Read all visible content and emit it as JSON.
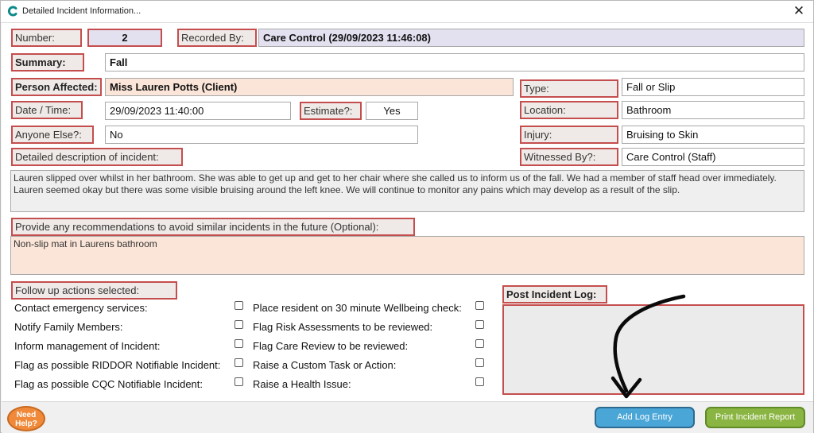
{
  "window": {
    "title": "Detailed Incident Information...",
    "close_glyph": "✕"
  },
  "form": {
    "number_label": "Number:",
    "number_value": "2",
    "recorded_by_label": "Recorded By:",
    "recorded_by_value": "Care Control (29/09/2023 11:46:08)",
    "summary_label": "Summary:",
    "summary_value": "Fall",
    "person_affected_label": "Person Affected:",
    "person_affected_value": "Miss Lauren Potts (Client)",
    "type_label": "Type:",
    "type_value": "Fall or Slip",
    "datetime_label": "Date / Time:",
    "datetime_value": "29/09/2023 11:40:00",
    "estimate_label": "Estimate?:",
    "estimate_value": "Yes",
    "location_label": "Location:",
    "location_value": "Bathroom",
    "anyone_else_label": "Anyone Else?:",
    "anyone_else_value": "No",
    "injury_label": "Injury:",
    "injury_value": "Bruising to Skin",
    "description_label": "Detailed description of incident:",
    "witnessed_by_label": "Witnessed By?:",
    "witnessed_by_value": "Care Control (Staff)",
    "description_text": "Lauren slipped over whilst in her bathroom. She was able to get up and get to her chair where she called us to inform us of the fall. We had a member of staff head over immediately. Lauren seemed okay but there was some visible bruising around the left knee. We will continue to monitor any pains which may develop as a result of the slip.",
    "recommendations_label": "Provide any recommendations to avoid similar incidents in the future (Optional):",
    "recommendations_text": "Non-slip mat in Laurens bathroom"
  },
  "follow_up": {
    "label": "Follow up actions selected:",
    "left_actions": [
      {
        "label": "Contact emergency services:",
        "checked": false
      },
      {
        "label": "Notify Family Members:",
        "checked": false
      },
      {
        "label": "Inform management of Incident:",
        "checked": false
      },
      {
        "label": "Flag as possible RIDDOR Notifiable Incident:",
        "checked": false
      },
      {
        "label": "Flag as possible CQC Notifiable Incident:",
        "checked": false
      }
    ],
    "right_actions": [
      {
        "label": "Place resident on 30 minute Wellbeing check:",
        "checked": false
      },
      {
        "label": "Flag Risk Assessments to be reviewed:",
        "checked": false
      },
      {
        "label": "Flag Care Review to be reviewed:",
        "checked": false
      },
      {
        "label": "Raise a Custom Task or Action:",
        "checked": false
      },
      {
        "label": "Raise a Health Issue:",
        "checked": false
      }
    ]
  },
  "post_incident_log": {
    "label": "Post Incident Log:"
  },
  "footer": {
    "help_line1": "Need",
    "help_line2": "Help?",
    "add_log_label": "Add Log Entry",
    "print_label": "Print Incident Report"
  },
  "colors": {
    "label_border": "#c44e4e",
    "label_bg": "#efeae7",
    "purple_field": "#e3e0f0",
    "peach_field": "#fbe5d8",
    "help_button": "#f08a3a",
    "add_log_button": "#4ba6d8",
    "print_button": "#8bb543"
  },
  "icons": {
    "app": "app-c-icon",
    "close": "close-icon",
    "annotation": "curved-arrow-icon"
  }
}
